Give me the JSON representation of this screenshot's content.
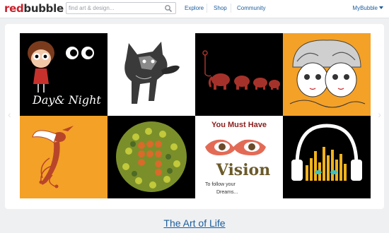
{
  "header": {
    "logo_red": "red",
    "logo_dark": "bubble",
    "search_placeholder": "find art & design...",
    "nav": [
      "Explore",
      "Shop",
      "Community"
    ],
    "account": "MyBubble"
  },
  "tiles": [
    {
      "name": "day-and-night",
      "text": "Day& Night"
    },
    {
      "name": "dog-sketch"
    },
    {
      "name": "elephants"
    },
    {
      "name": "twins-faces"
    },
    {
      "name": "hummingbird"
    },
    {
      "name": "color-blind-test"
    },
    {
      "name": "vision-poster",
      "line1": "You Must Have",
      "line2": "Vision",
      "line3": "To follow your",
      "line4": "Dreams..."
    },
    {
      "name": "headphones"
    }
  ],
  "caption": "The Art of Life",
  "colors": {
    "accent_link": "#1c5d9c",
    "brand_red": "#c9202b",
    "tile_orange": "#f4a127"
  }
}
